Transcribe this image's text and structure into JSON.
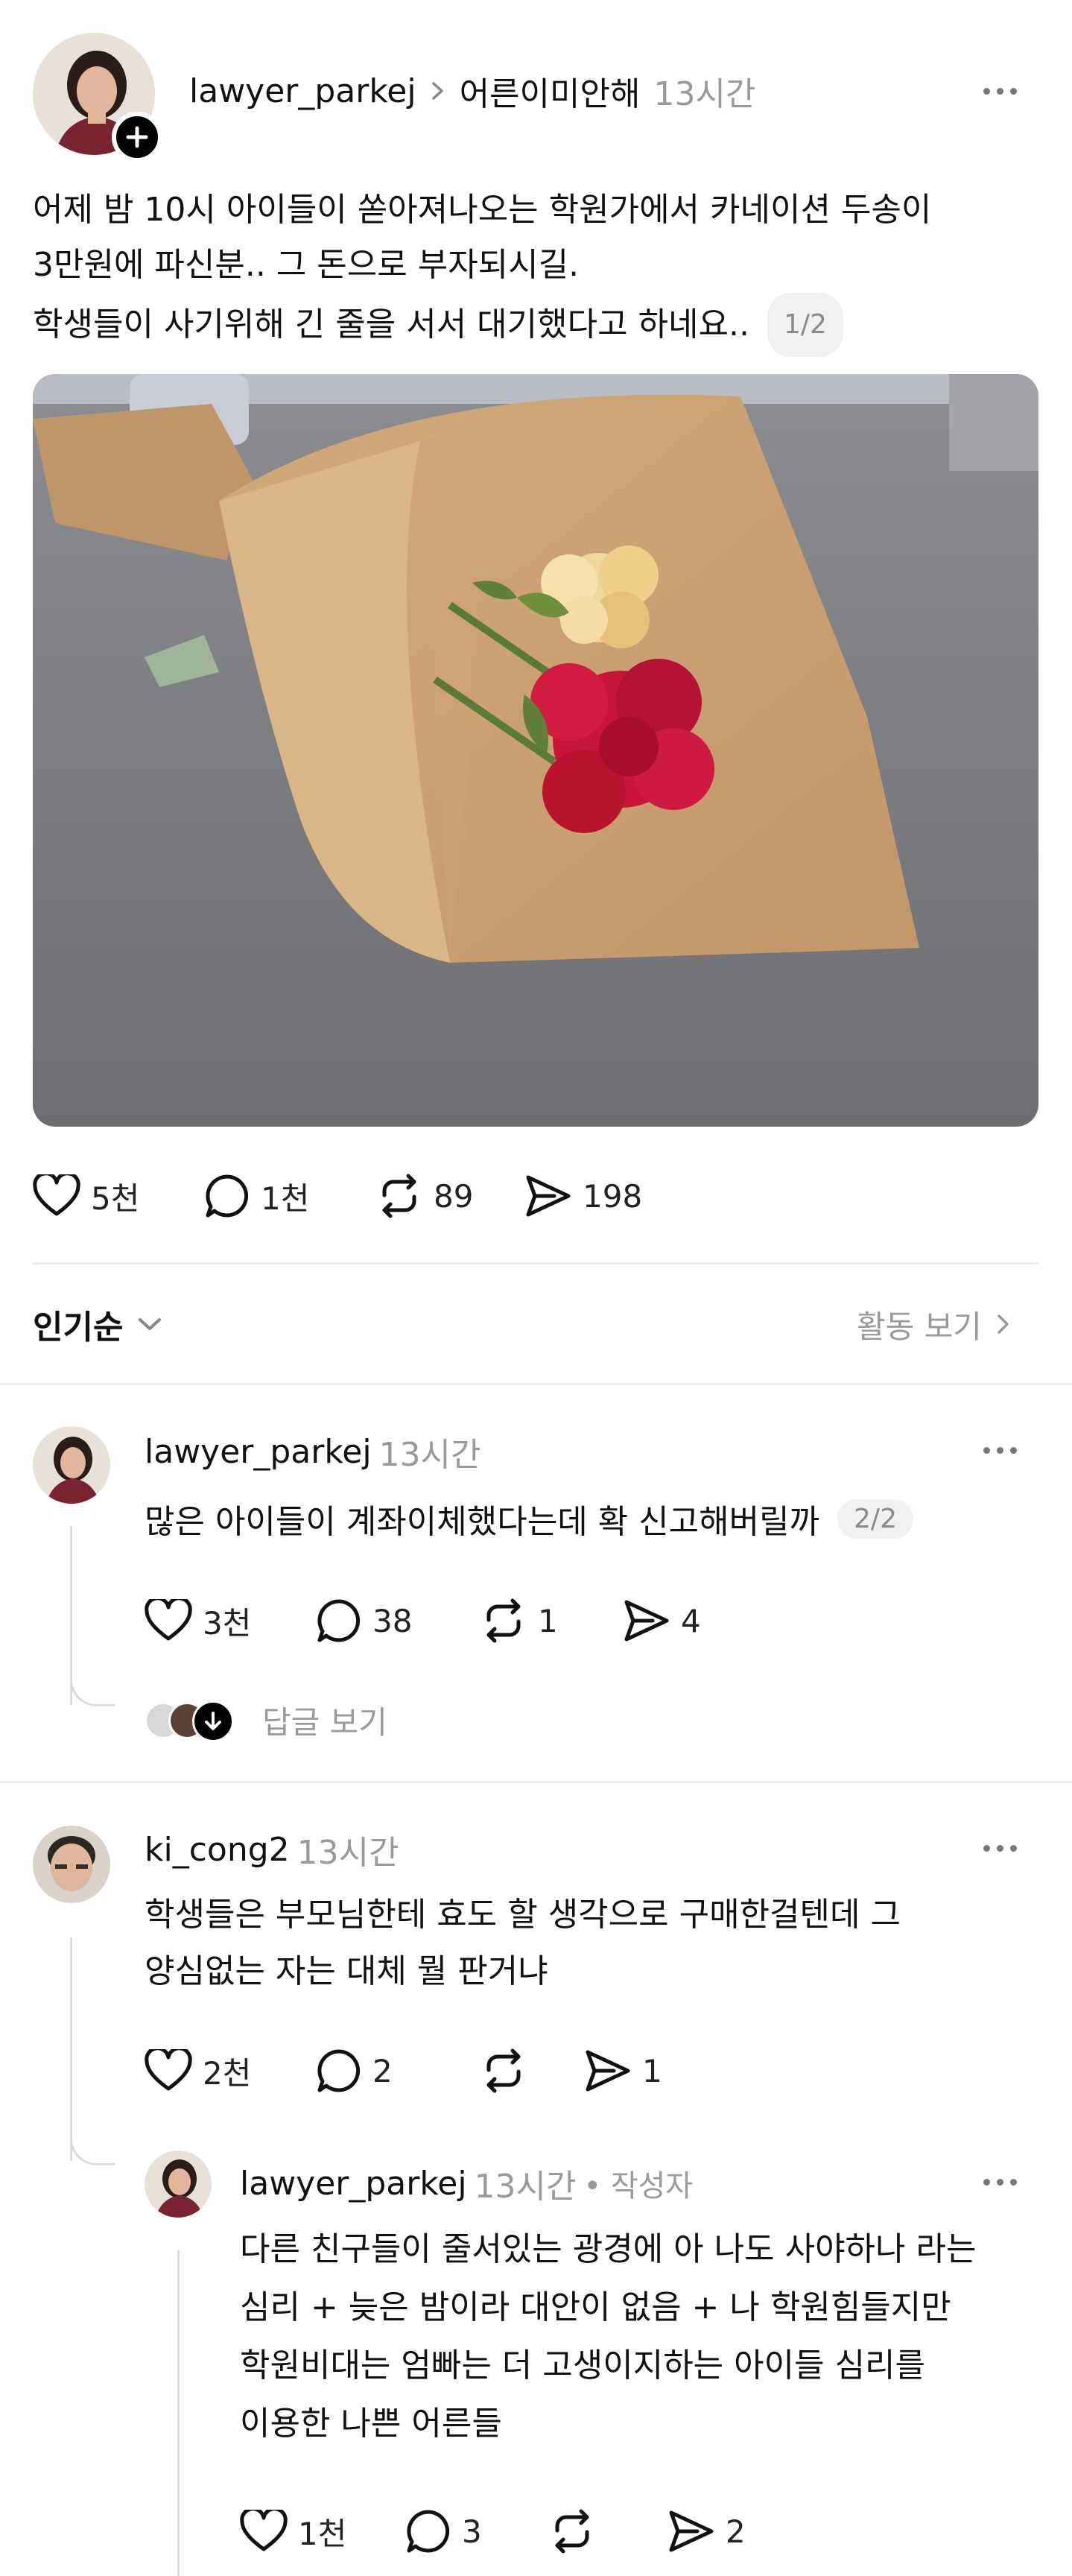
{
  "post": {
    "username": "lawyer_parkej",
    "community": "어른이미안해",
    "time": "13시간",
    "text_lines": [
      "어제 밤 10시 아이들이 쏟아져나오는 학원가에서 카네이션 두송이",
      "3만원에 파신분.. 그 돈으로 부자되시길.",
      "학생들이 사기위해 긴 줄을 서서 대기했다고 하네요.."
    ],
    "page_badge": "1/2",
    "likes": "5천",
    "comments": "1천",
    "reposts": "89",
    "shares": "198"
  },
  "sort": {
    "label": "인기순",
    "activity_label": "활동 보기"
  },
  "thread": [
    {
      "username": "lawyer_parkej",
      "time": "13시간",
      "text": "많은 아이들이 계좌이체했다는데 확 신고해버릴까",
      "page_badge": "2/2",
      "likes": "3천",
      "comments": "38",
      "reposts": "1",
      "shares": "4",
      "replies_label": "답글 보기"
    },
    {
      "username": "ki_cong2",
      "time": "13시간",
      "text_lines": [
        "학생들은 부모님한테 효도 할 생각으로 구매한걸텐데 그",
        "양심없는 자는 대체 뭘 판거냐"
      ],
      "likes": "2천",
      "comments": "2",
      "reposts": "",
      "shares": "1"
    },
    {
      "username": "lawyer_parkej",
      "time": "13시간",
      "author_tag": "• 작성자",
      "text_lines": [
        "다른 친구들이 줄서있는 광경에 아 나도 사야하나 라는",
        "심리 + 늦은 밤이라 대안이 없음 + 나 학원힘들지만",
        "학원비대는 엄빠는 더 고생이지하는 아이들 심리를",
        "이용한 나쁜 어른들"
      ],
      "likes": "1천",
      "comments": "3",
      "reposts": "",
      "shares": "2"
    }
  ],
  "icons": {
    "like": "heart-icon",
    "comment": "comment-bubble-icon",
    "repost": "repost-icon",
    "share": "send-icon",
    "follow": "plus-icon",
    "more": "more-dots-icon"
  }
}
